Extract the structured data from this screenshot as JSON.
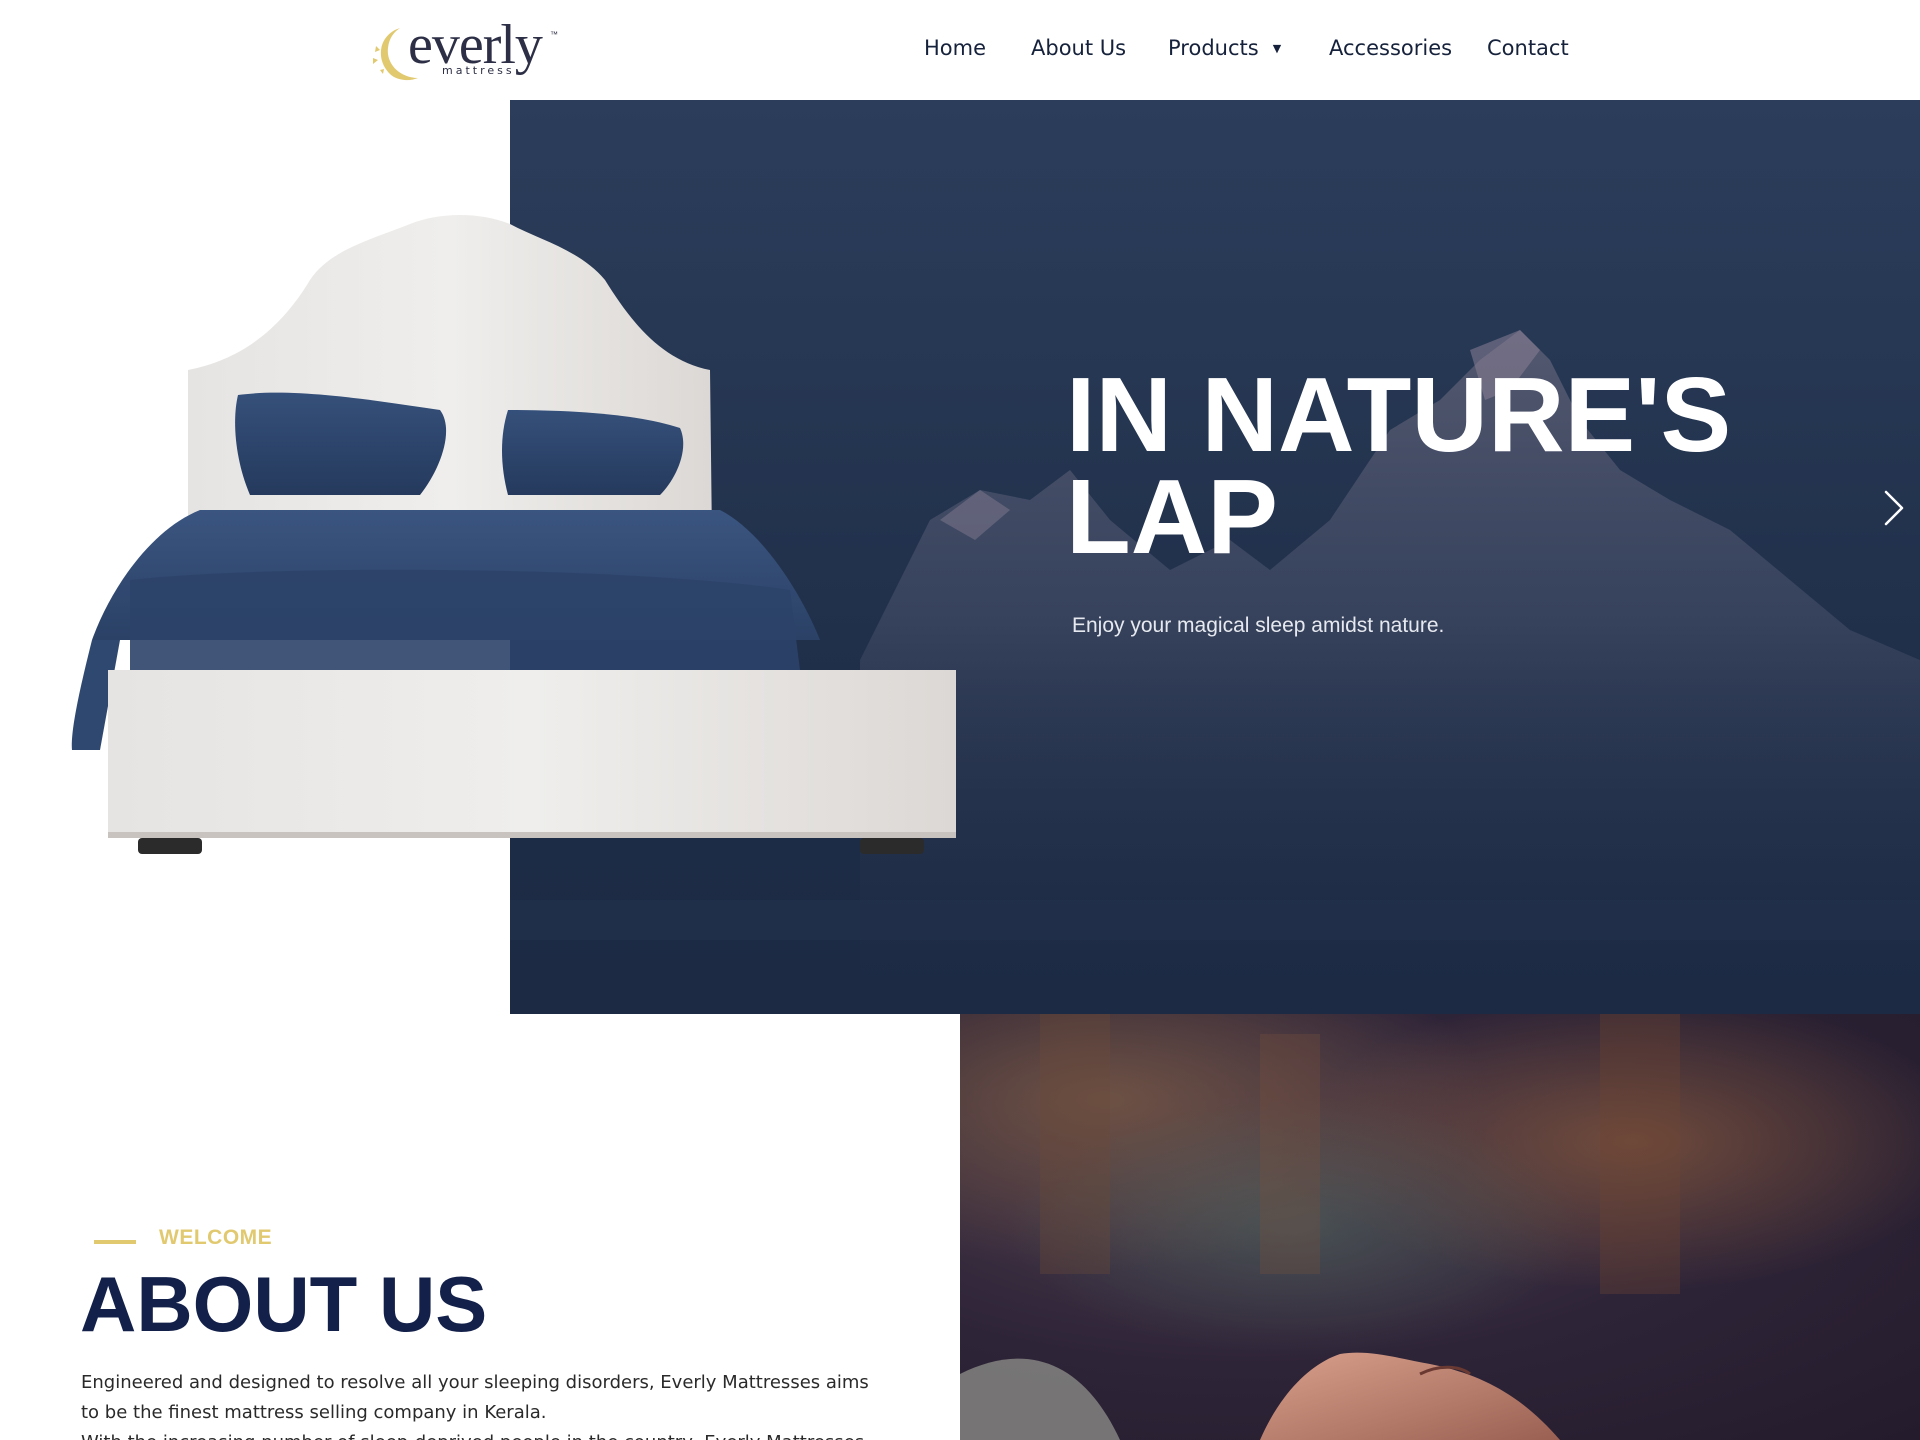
{
  "brand": {
    "name": "everly",
    "tagline": "mattress",
    "trademark": "™",
    "accent": "#e1c970",
    "navy": "#13204a"
  },
  "nav": {
    "items": [
      {
        "label": "Home"
      },
      {
        "label": "About Us"
      },
      {
        "label": "Products",
        "has_dropdown": true,
        "caret": "▼"
      },
      {
        "label": "Accessories"
      },
      {
        "label": "Contact"
      }
    ]
  },
  "hero": {
    "title": "IN NATURE'S LAP",
    "subtitle": "Enjoy your magical sleep amidst nature.",
    "background": "#263753",
    "next_icon": "chevron-right-icon"
  },
  "about": {
    "eyebrow": "WELCOME",
    "title": "ABOUT US",
    "paragraph_1": "Engineered and designed to resolve all your sleeping disorders, Everly Mattresses aims to be the finest mattress selling company in Kerala.",
    "paragraph_2": "With the increasing number of sleep-deprived people in the country, Everly Mattresses intent to"
  }
}
